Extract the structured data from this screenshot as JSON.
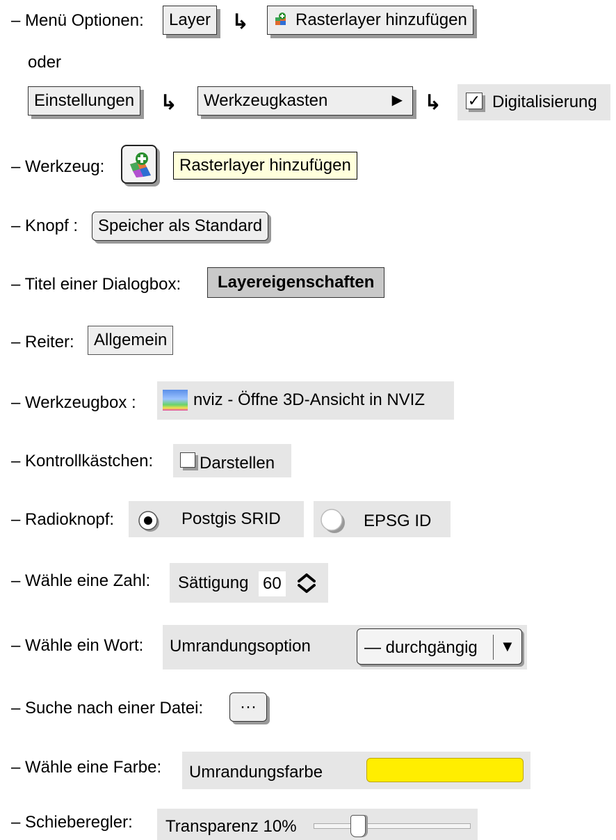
{
  "rows": {
    "menu": {
      "label": "– Menü Optionen:",
      "layer_menu": "Layer",
      "add_raster_menu_item": "Rasterlayer hinzufügen",
      "arrow": "↳",
      "or": "oder",
      "settings_menu": "Einstellungen",
      "toolbox_menu": "Werkzeugkasten",
      "submenu_triangle": "▶",
      "digitizing_item": "Digitalisierung",
      "check_mark": "✓"
    },
    "tool": {
      "label": "– Werkzeug:",
      "tooltip": "Rasterlayer hinzufügen"
    },
    "button": {
      "label": "– Knopf :",
      "value": "Speicher als Standard"
    },
    "dialog": {
      "label": "– Titel einer Dialogbox:",
      "value": "Layereigenschaften"
    },
    "tab": {
      "label": "– Reiter:",
      "value": "Allgemein"
    },
    "toolbox": {
      "label": "– Werkzeugbox :",
      "value": "nviz - Öffne 3D-Ansicht in NVIZ"
    },
    "checkbox": {
      "label": "– Kontrollkästchen:",
      "value": "Darstellen"
    },
    "radio": {
      "label": "– Radioknopf:",
      "option1": "Postgis SRID",
      "option2": "EPSG ID",
      "selected": "Postgis SRID"
    },
    "spinbox": {
      "label": "– Wähle eine Zahl:",
      "field": "Sättigung",
      "value": "60"
    },
    "combobox": {
      "label": "– Wähle ein Wort:",
      "field": "Umrandungsoption",
      "value": "— durchgängig",
      "dropdown_glyph": "▼"
    },
    "file": {
      "label": "– Suche nach einer Datei:",
      "button": "···"
    },
    "color": {
      "label": "– Wähle eine Farbe:",
      "field": "Umrandungsfarbe",
      "color": "#ffee00"
    },
    "slider": {
      "label": "– Schieberegler:",
      "field": "Transparenz 10%",
      "value_percent": 10
    }
  }
}
